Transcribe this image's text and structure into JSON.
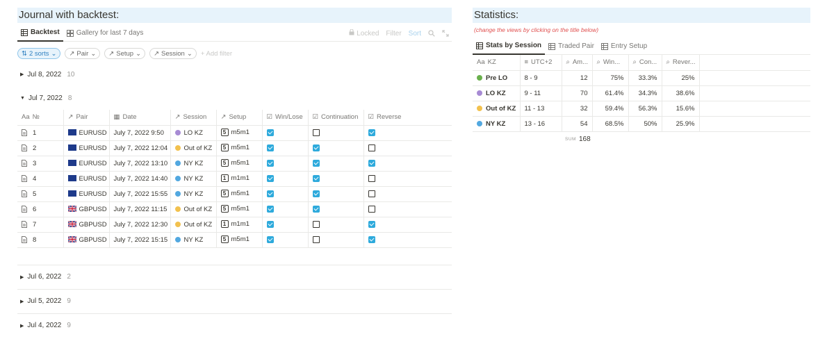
{
  "left": {
    "title": "Journal with backtest:",
    "tabs": [
      {
        "label": "Backtest",
        "active": true
      },
      {
        "label": "Gallery for last 7 days",
        "active": false
      }
    ],
    "toolbar": {
      "locked": "Locked",
      "filter": "Filter",
      "sort": "Sort"
    },
    "filters": {
      "sorts": "2 sorts",
      "pair": "Pair",
      "setup": "Setup",
      "session": "Session",
      "add_filter": "Add filter"
    },
    "groups_before": [
      {
        "date": "Jul 8, 2022",
        "count": "10"
      }
    ],
    "open_group": {
      "date": "Jul 7, 2022",
      "count": "8"
    },
    "columns": [
      "№",
      "Pair",
      "Date",
      "Session",
      "Setup",
      "Win/Lose",
      "Continuation",
      "Reverse"
    ],
    "rows": [
      {
        "n": "1",
        "pair": "EURUSD",
        "flag": "eu",
        "date": "July 7, 2022 9:50",
        "session": "LO KZ",
        "session_color": "#a78bd4",
        "setup_num": "5",
        "setup": "m5m1",
        "win": true,
        "cont": false,
        "rev": true
      },
      {
        "n": "2",
        "pair": "EURUSD",
        "flag": "eu",
        "date": "July 7, 2022 12:04",
        "session": "Out of KZ",
        "session_color": "#f2c14e",
        "setup_num": "5",
        "setup": "m5m1",
        "win": true,
        "cont": true,
        "rev": false
      },
      {
        "n": "3",
        "pair": "EURUSD",
        "flag": "eu",
        "date": "July 7, 2022 13:10",
        "session": "NY KZ",
        "session_color": "#52a8e0",
        "setup_num": "5",
        "setup": "m5m1",
        "win": true,
        "cont": true,
        "rev": true
      },
      {
        "n": "4",
        "pair": "EURUSD",
        "flag": "eu",
        "date": "July 7, 2022 14:40",
        "session": "NY KZ",
        "session_color": "#52a8e0",
        "setup_num": "1",
        "setup": "m1m1",
        "win": true,
        "cont": true,
        "rev": false
      },
      {
        "n": "5",
        "pair": "EURUSD",
        "flag": "eu",
        "date": "July 7, 2022 15:55",
        "session": "NY KZ",
        "session_color": "#52a8e0",
        "setup_num": "5",
        "setup": "m5m1",
        "win": true,
        "cont": true,
        "rev": false
      },
      {
        "n": "6",
        "pair": "GBPUSD",
        "flag": "uk",
        "date": "July 7, 2022 11:15",
        "session": "Out of KZ",
        "session_color": "#f2c14e",
        "setup_num": "5",
        "setup": "m5m1",
        "win": true,
        "cont": true,
        "rev": false
      },
      {
        "n": "7",
        "pair": "GBPUSD",
        "flag": "uk",
        "date": "July 7, 2022 12:30",
        "session": "Out of KZ",
        "session_color": "#f2c14e",
        "setup_num": "1",
        "setup": "m1m1",
        "win": true,
        "cont": false,
        "rev": true
      },
      {
        "n": "8",
        "pair": "GBPUSD",
        "flag": "uk",
        "date": "July 7, 2022 15:15",
        "session": "NY KZ",
        "session_color": "#52a8e0",
        "setup_num": "5",
        "setup": "m5m1",
        "win": true,
        "cont": false,
        "rev": true
      }
    ],
    "groups_after": [
      {
        "date": "Jul 6, 2022",
        "count": "2"
      },
      {
        "date": "Jul 5, 2022",
        "count": "9"
      },
      {
        "date": "Jul 4, 2022",
        "count": "9"
      }
    ]
  },
  "right": {
    "title": "Statistics:",
    "subtitle": "(change the views by clicking on the title below)",
    "tabs": [
      {
        "label": "Stats by Session",
        "active": true
      },
      {
        "label": "Traded Pair",
        "active": false
      },
      {
        "label": "Entry Setup",
        "active": false
      }
    ],
    "columns": [
      "KZ",
      "UTC+2",
      "Am...",
      "Win...",
      "Con...",
      "Rever..."
    ],
    "rows": [
      {
        "kz": "Pre LO",
        "color": "#6ab04c",
        "utc": "8 - 9",
        "amount": "12",
        "win": "75%",
        "con": "33.3%",
        "rev": "25%"
      },
      {
        "kz": "LO KZ",
        "color": "#a78bd4",
        "utc": "9 - 11",
        "amount": "70",
        "win": "61.4%",
        "con": "34.3%",
        "rev": "38.6%"
      },
      {
        "kz": "Out of KZ",
        "color": "#f2c14e",
        "utc": "11 - 13",
        "amount": "32",
        "win": "59.4%",
        "con": "56.3%",
        "rev": "15.6%"
      },
      {
        "kz": "NY KZ",
        "color": "#52a8e0",
        "utc": "13 - 16",
        "amount": "54",
        "win": "68.5%",
        "con": "50%",
        "rev": "25.9%"
      }
    ],
    "sum_label": "SUM",
    "sum_value": "168"
  }
}
